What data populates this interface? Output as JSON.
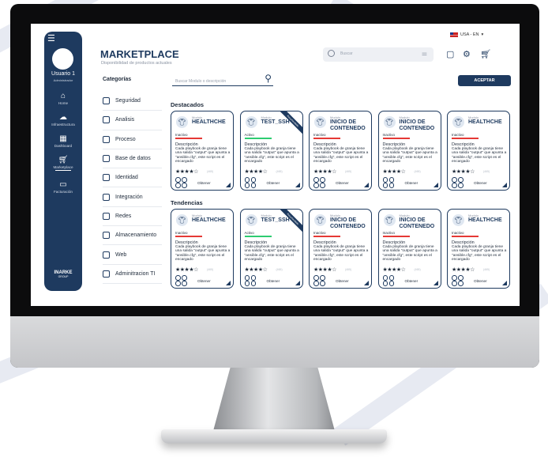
{
  "sidebar": {
    "user_name": "Usuario 1",
    "user_role": "Administrador",
    "items": [
      {
        "label": "Home",
        "icon": "home-icon"
      },
      {
        "label": "Infraestructura",
        "icon": "cloud-icon"
      },
      {
        "label": "Dashboard",
        "icon": "grid-icon"
      },
      {
        "label": "Marketplace",
        "icon": "cart-icon"
      },
      {
        "label": "Facturación",
        "icon": "monitor-icon"
      }
    ],
    "brand": "INARKE",
    "brand_sub": "GROUP"
  },
  "header": {
    "title": "MARKETPLACE",
    "subtitle": "Disponibilidad de productos actuales",
    "search_placeholder": "Buscar",
    "language": "USA - EN"
  },
  "accept_label": "ACEPTAR",
  "categories": {
    "title": "Categorías",
    "search_placeholder": "Buscar Modulo o descripción",
    "items": [
      "Seguridad",
      "Analisis",
      "Proceso",
      "Base de datos",
      "Identidad",
      "Integración",
      "Redes",
      "Almacenamiento",
      "Web",
      "Adminitracion TI"
    ]
  },
  "sections": {
    "featured": "Destacados",
    "trending": "Tendencias"
  },
  "card_common": {
    "module_label": "Modulo",
    "desc_label": "Descripción",
    "desc_text": "Cada playbook de granja tiene una salida \"output\" que apunta a \"ansible.cfg\", este script es el encargado",
    "stars": "★★★★☆",
    "rating": "(465)",
    "get_label": "Obtener"
  },
  "featured_cards": [
    {
      "name": "HEALTHCHE",
      "status": "Inactivo",
      "status_color": "#e53935",
      "ribbon": ""
    },
    {
      "name": "TEST_SSH",
      "status": "Activo",
      "status_color": "#2ecc71",
      "ribbon": "Recomendado"
    },
    {
      "name": "INICIO DE CONTENEDO",
      "status": "Inactivo",
      "status_color": "#e53935",
      "ribbon": ""
    },
    {
      "name": "INICIO DE CONTENEDO",
      "status": "Inactivo",
      "status_color": "#e53935",
      "ribbon": ""
    },
    {
      "name": "HEALTHCHE",
      "status": "Inactivo",
      "status_color": "#e53935",
      "ribbon": ""
    }
  ],
  "trending_cards": [
    {
      "name": "HEALTHCHE",
      "status": "Inactivo",
      "status_color": "#e53935",
      "ribbon": ""
    },
    {
      "name": "TEST_SSH",
      "status": "Activo",
      "status_color": "#2ecc71",
      "ribbon": "Recomendado"
    },
    {
      "name": "INICIO DE CONTENEDO",
      "status": "Inactivo",
      "status_color": "#e53935",
      "ribbon": ""
    },
    {
      "name": "INICIO DE CONTENEDO",
      "status": "Inactivo",
      "status_color": "#e53935",
      "ribbon": ""
    },
    {
      "name": "HEALTHCHE",
      "status": "Inactivo",
      "status_color": "#e53935",
      "ribbon": ""
    }
  ]
}
